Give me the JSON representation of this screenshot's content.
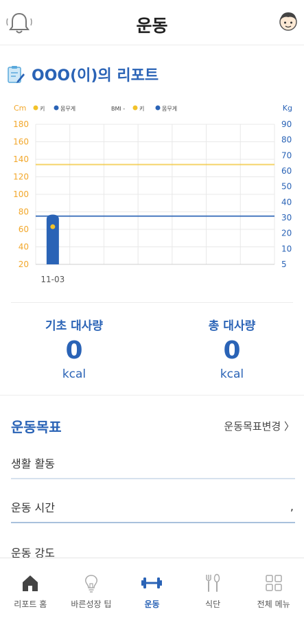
{
  "header": {
    "title": "운동"
  },
  "report": {
    "title": "OOO(이)의 리포트"
  },
  "chart_data": {
    "type": "line",
    "left_unit": "Cm",
    "right_unit": "Kg",
    "legend_left": [
      {
        "name": "키",
        "color": "#f2c22a"
      },
      {
        "name": "몸무게",
        "color": "#2a63b6"
      }
    ],
    "legend_right_prefix": "BMI -",
    "legend_right": [
      {
        "name": "키",
        "color": "#f2c22a"
      },
      {
        "name": "몸무게",
        "color": "#2a63b6"
      }
    ],
    "y_left_ticks": [
      "180",
      "160",
      "140",
      "120",
      "100",
      "80",
      "60",
      "40",
      "20"
    ],
    "y_left_range": [
      20,
      180
    ],
    "y_right_ticks": [
      "90",
      "80",
      "70",
      "60",
      "50",
      "40",
      "30",
      "20",
      "10",
      "5"
    ],
    "y_right_range": [
      5,
      90
    ],
    "x_labels": [
      "11-03"
    ],
    "height_point": {
      "x": "11-03",
      "value": 63
    },
    "height_reference_line": 134,
    "weight_bar": {
      "x": "11-03",
      "value": 32
    },
    "weight_reference_line": 31,
    "colors": {
      "height": "#f2c22a",
      "weight": "#2a63b6",
      "left_axis": "#f2a72a",
      "right_axis": "#2a63b6"
    }
  },
  "metrics": {
    "basal": {
      "label": "기초 대사량",
      "value": "0",
      "unit": "kcal"
    },
    "total": {
      "label": "총 대사량",
      "value": "0",
      "unit": "kcal"
    }
  },
  "goal": {
    "title": "운동목표",
    "change_label": "운동목표변경 〉",
    "fields": [
      {
        "label": "생활 활동",
        "value": ""
      },
      {
        "label": "운동 시간",
        "value": ","
      },
      {
        "label": "운동 강도",
        "value": ""
      }
    ]
  },
  "tabs": [
    {
      "label": "리포트 홈",
      "icon": "home-icon"
    },
    {
      "label": "바른성장 팁",
      "icon": "lightbulb-icon"
    },
    {
      "label": "운동",
      "icon": "dumbbell-icon"
    },
    {
      "label": "식단",
      "icon": "fork-spoon-icon"
    },
    {
      "label": "전체 메뉴",
      "icon": "grid-menu-icon"
    }
  ],
  "active_tab": 2,
  "accent_color": "#2a63b6"
}
